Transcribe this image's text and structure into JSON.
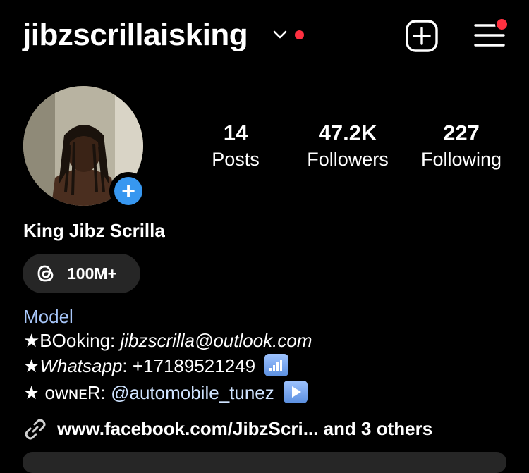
{
  "header": {
    "username": "jibzscrillaisking",
    "chevron_icon": "chevron-down-icon",
    "new_post_icon": "plus-square-icon",
    "menu_icon": "hamburger-menu-icon",
    "notification_color": "#ff3040"
  },
  "profile": {
    "display_name": "King Jibz Scrilla",
    "stats": [
      {
        "value": "14",
        "label": "Posts"
      },
      {
        "value": "47.2K",
        "label": "Followers"
      },
      {
        "value": "227",
        "label": "Following"
      }
    ],
    "threads": {
      "icon": "threads-icon",
      "count": "100M+"
    },
    "bio": {
      "category": "Model",
      "line1_prefix": "★BOoking: ",
      "line1_email": "jibzscrilla@outlook.com",
      "line2_star": "★",
      "line2_label": "Whatsapp",
      "line2_value": ": +17189521249",
      "line2_emoji": "signal-bars-emoji",
      "line3_prefix": "★ ᴏᴡɴᴇR: ",
      "line3_mention": "@automobile_tunez",
      "line3_emoji": "play-button-emoji"
    },
    "link": {
      "icon": "link-icon",
      "text": "www.facebook.com/JibzScri...  and 3 others"
    },
    "accent_color": "#3797f0"
  }
}
